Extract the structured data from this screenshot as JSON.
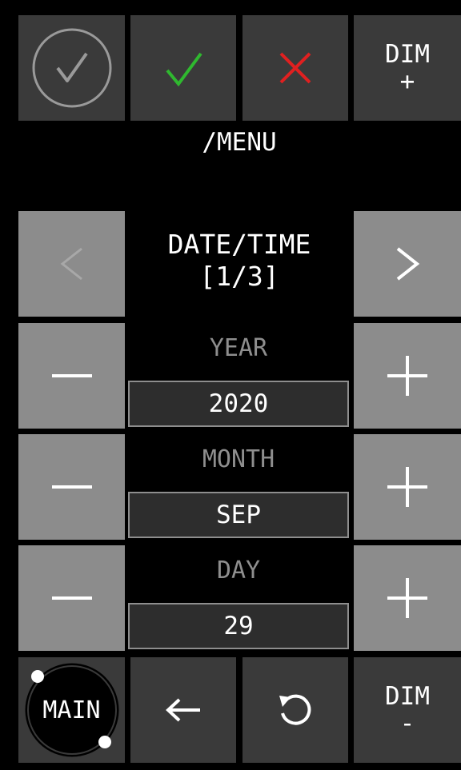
{
  "top_bar": {
    "dim_plus_label": "DIM",
    "dim_plus_sign": "+"
  },
  "menu_title": "/MENU",
  "page": {
    "title": "DATE/TIME",
    "indicator": "[1/3]"
  },
  "fields": [
    {
      "label": "YEAR",
      "value": "2020"
    },
    {
      "label": "MONTH",
      "value": "SEP"
    },
    {
      "label": "DAY",
      "value": "29"
    }
  ],
  "bottom_bar": {
    "main_label": "MAIN",
    "dim_minus_label": "DIM",
    "dim_minus_sign": "-"
  },
  "colors": {
    "confirm": "#2fb82f",
    "cancel": "#e02020",
    "disabled": "#8c8c8c",
    "button_dark": "#3a3a3a"
  },
  "icons": [
    "circle-check-icon",
    "check-icon",
    "cross-icon",
    "chevron-left-icon",
    "chevron-right-icon",
    "minus-icon",
    "plus-icon",
    "arrow-left-icon",
    "refresh-icon"
  ]
}
